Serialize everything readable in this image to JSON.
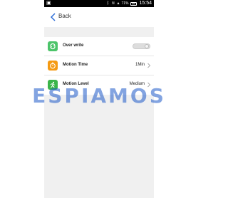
{
  "status_bar": {
    "time": "15:54",
    "battery": "71%",
    "icons": [
      "gallery-icon",
      "bluetooth-icon",
      "wifi-icon",
      "signal-icon",
      "battery-icon"
    ]
  },
  "nav": {
    "back_label": "Back",
    "back_icon": "chevron-left-icon",
    "accent_color": "#2f6fd8"
  },
  "settings": {
    "rows": [
      {
        "label": "Over write",
        "icon": "refresh-icon",
        "icon_color": "#4cc46a",
        "control": "toggle",
        "toggle_state": "off"
      },
      {
        "label": "Motion Time",
        "icon": "timer-icon",
        "icon_color": "#f59a12",
        "control": "value",
        "value": "1Min"
      },
      {
        "label": "Motion Level",
        "icon": "running-icon",
        "icon_color": "#3ab54a",
        "control": "value",
        "value": "Medium"
      }
    ]
  },
  "watermark": {
    "text": "ESPIAMOS"
  }
}
